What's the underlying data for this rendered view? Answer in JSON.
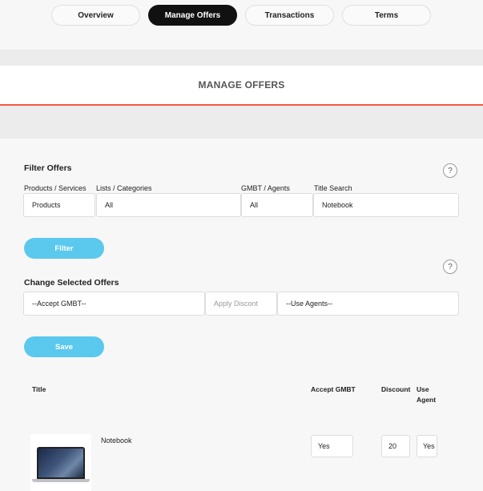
{
  "tabs": [
    {
      "label": "Overview",
      "active": false
    },
    {
      "label": "Manage Offers",
      "active": true
    },
    {
      "label": "Transactions",
      "active": false
    },
    {
      "label": "Terms",
      "active": false
    }
  ],
  "banner": {
    "title": "MANAGE OFFERS"
  },
  "filter": {
    "title": "Filter Offers",
    "help_glyph": "?",
    "labels": {
      "products_services": "Products / Services",
      "lists_categories": "Lists / Categories",
      "gmbt_agents": "GMBT / Agents",
      "title_search": "Title Search"
    },
    "values": {
      "products_services": "Products",
      "lists_categories": "All",
      "gmbt_agents": "All",
      "title_search": "Notebook"
    },
    "button": "Filter"
  },
  "change": {
    "title": "Change Selected Offers",
    "help_glyph": "?",
    "accept_gmbt": "--Accept GMBT--",
    "apply_discount_placeholder": "Apply Discont",
    "use_agents": "--Use Agents--",
    "button": "Save"
  },
  "table": {
    "headers": {
      "title": "Title",
      "accept_gmbt": "Accept GMBT",
      "discount": "Discount",
      "use_agent_line1": "Use",
      "use_agent_line2": "Agent"
    },
    "rows": [
      {
        "title": "Notebook",
        "accept_gmbt": "Yes",
        "discount": "20",
        "use_agent": "Yes",
        "image": "laptop"
      }
    ]
  },
  "colors": {
    "accent_blue": "#5bc8ee",
    "accent_orange": "#f05a3e",
    "active_tab": "#111111"
  }
}
